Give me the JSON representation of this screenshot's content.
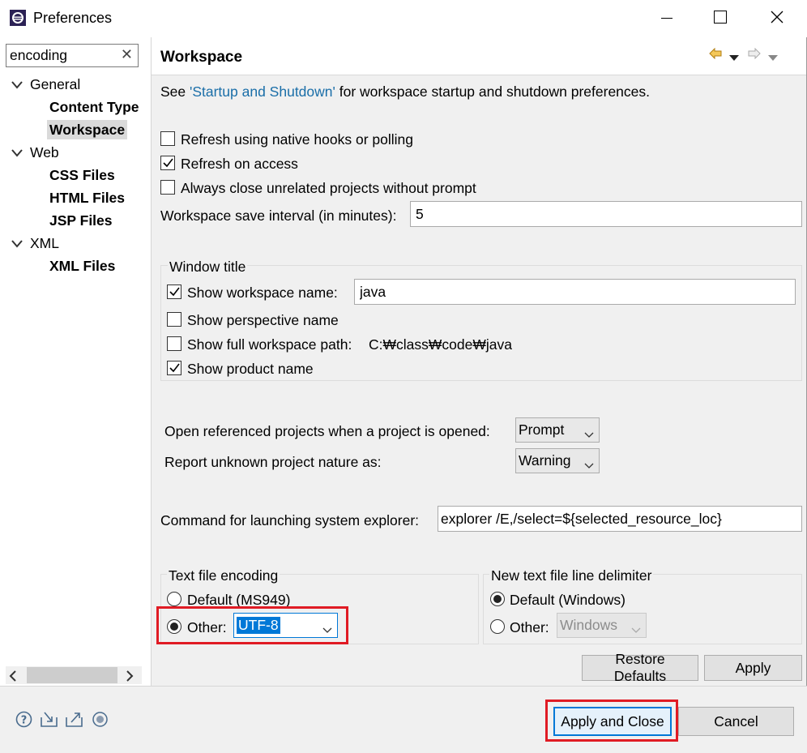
{
  "window": {
    "title": "Preferences"
  },
  "sidebar": {
    "filter_value": "encoding",
    "tree": [
      {
        "label": "General",
        "children": [
          "Content Type",
          "Workspace"
        ]
      },
      {
        "label": "Web",
        "children": [
          "CSS Files",
          "HTML Files",
          "JSP Files"
        ]
      },
      {
        "label": "XML",
        "children": [
          "XML Files"
        ]
      }
    ]
  },
  "page": {
    "title": "Workspace",
    "intro_see": "See ",
    "intro_link": "'Startup and Shutdown'",
    "intro_rest": " for workspace startup and shutdown preferences.",
    "refresh_native": "Refresh using native hooks or polling",
    "refresh_access": "Refresh on access",
    "always_close": "Always close unrelated projects without prompt",
    "save_interval_label": "Workspace save interval (in minutes):",
    "save_interval_value": "5",
    "window_title_group": "Window title",
    "show_ws_name": "Show workspace name:",
    "ws_name_value": "java",
    "show_perspective": "Show perspective name",
    "show_full_path": "Show full workspace path:",
    "full_path_value": "C:₩class₩code₩java",
    "show_product": "Show product name",
    "open_ref_label": "Open referenced projects when a project is opened:",
    "open_ref_value": "Prompt",
    "unknown_nature_label": "Report unknown project nature as:",
    "unknown_nature_value": "Warning",
    "cmd_label": "Command for launching system explorer:",
    "cmd_value": "explorer /E,/select=${selected_resource_loc}",
    "encoding_group": "Text file encoding",
    "enc_default": "Default (MS949)",
    "enc_other": "Other:",
    "enc_other_value": "UTF-8",
    "delim_group": "New text file line delimiter",
    "delim_default": "Default (Windows)",
    "delim_other": "Other:",
    "delim_other_value": "Windows",
    "restore_defaults": "Restore Defaults",
    "apply": "Apply"
  },
  "footer": {
    "apply_close": "Apply and Close",
    "cancel": "Cancel"
  },
  "checkbox_state": {
    "refresh_native": false,
    "refresh_access": true,
    "always_close": false,
    "show_ws_name": true,
    "show_perspective": false,
    "show_full_path": false,
    "show_product": true
  },
  "colors": {
    "link": "#1a6ea8",
    "highlight_box": "#e01b24",
    "selection": "#0078d7"
  }
}
